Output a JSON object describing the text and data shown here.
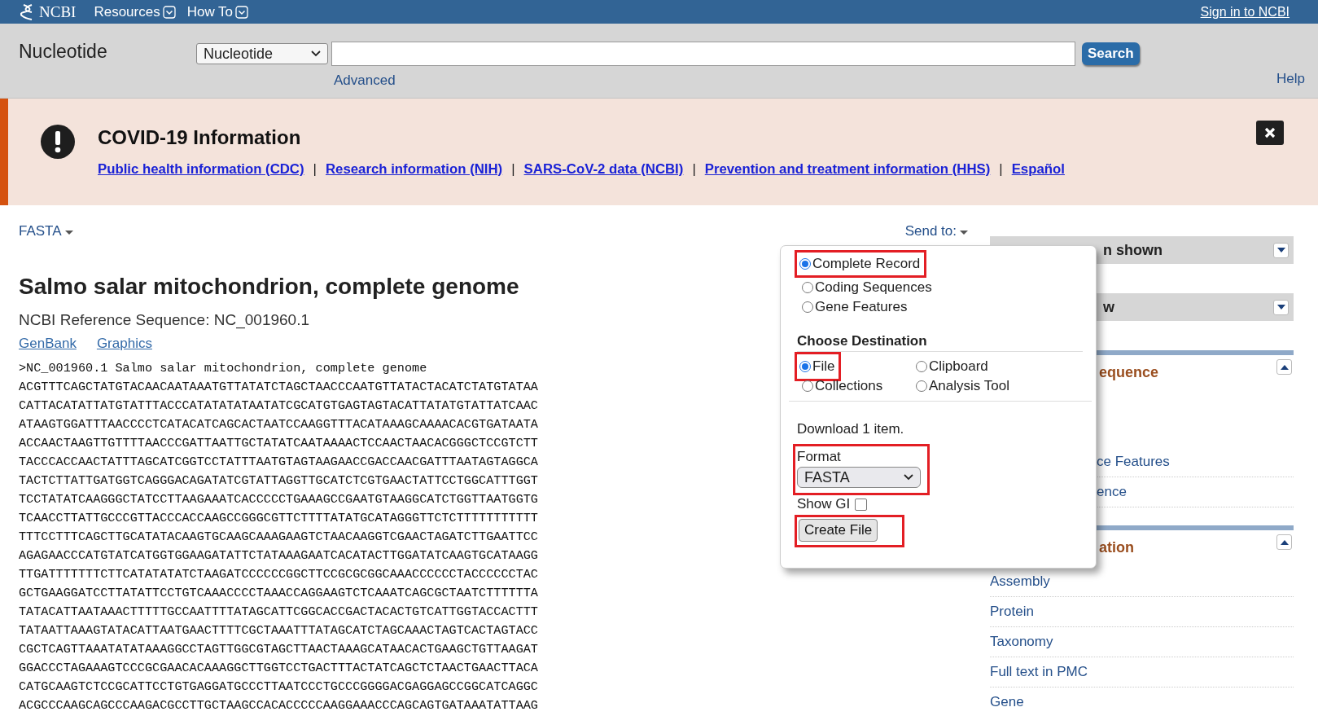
{
  "topbar": {
    "logo": "NCBI",
    "menus": [
      {
        "label": "Resources"
      },
      {
        "label": "How To"
      }
    ],
    "sign_in": "Sign in to NCBI"
  },
  "search": {
    "title": "Nucleotide",
    "database": "Nucleotide",
    "button": "Search",
    "advanced": "Advanced",
    "help": "Help"
  },
  "banner": {
    "title": "COVID-19 Information",
    "links": [
      "Public health information (CDC)",
      "Research information (NIH)",
      "SARS-CoV-2 data (NCBI)",
      "Prevention and treatment information (HHS)",
      "Español"
    ],
    "separator": "|"
  },
  "record": {
    "format": "FASTA",
    "send_to": "Send to:",
    "title": "Salmo salar mitochondrion, complete genome",
    "subtitle": "NCBI Reference Sequence: NC_001960.1",
    "links": [
      "GenBank",
      "Graphics"
    ],
    "fasta_header": ">NC_001960.1 Salmo salar mitochondrion, complete genome",
    "sequence": [
      "ACGTTTCAGCTATGTACAACAATAAATGTTATATCTAGCTAACCCAATGTTATACTACATCTATGTATAA",
      "CATTACATATTATGTATTTACCCATATATATAATATCGCATGTGAGTAGTACATTATATGTATTATCAAC",
      "ATAAGTGGATTTAACCCCTCATACATCAGCACTAATCCAAGGTTTACATAAAGCAAAACACGTGATAATA",
      "ACCAACTAAGTTGTTTTAACCCGATTAATTGCTATATCAATAAAACTCCAACTAACACGGGCTCCGTCTT",
      "TACCCACCAACTATTTAGCATCGGTCCTATTTAATGTAGTAAGAACCGACCAACGATTTAATAGTAGGCA",
      "TACTCTTATTGATGGTCAGGGACAGATATCGTATTAGGTTGCATCTCGTGAACTATTCCTGGCATTTGGT",
      "TCCTATATCAAGGGCTATCCTTAAGAAATCACCCCCTGAAAGCCGAATGTAAGGCATCTGGTTAATGGTG",
      "TCAACCTTATTGCCCGTTACCCACCAAGCCGGGCGTTCTTTTATATGCATAGGGTTCTCTTTTTTTTTTT",
      "TTTCCTTTCAGCTTGCATATACAAGTGCAAGCAAAGAAGTCTAACAAGGTCGAACTAGATCTTGAATTCC",
      "AGAGAACCCATGTATCATGGTGGAAGATATTCTATAAAGAATCACATACTTGGATATCAAGTGCATAAGG",
      "TTGATTTTTTTCTTCATATATATCTAAGATCCCCCCGGCTTCCGCGCGGCAAACCCCCCTACCCCCCTAC",
      "GCTGAAGGATCCTTATATTCCTGTCAAACCCCTAAACCAGGAAGTCTCAAATCAGCGCTAATCTTTTTTA",
      "TATACATTAATAAACTTTTTGCCAATTTTATAGCATTCGGCACCGACTACACTGTCATTGGTACCACTTT",
      "TATAATTAAAGTATACATTAATGAACTTTTCGCTAAATTTATAGCATCTAGCAAACTAGTCACTAGTACC",
      "CGCTCAGTTAAATATATAAAGGCCTAGTTGGCGTAGCTTAACTAAAGCATAACACTGAAGCTGTTAAGAT",
      "GGACCCTAGAAAGTCCCGCGAACACAAAGGCTTGGTCCTGACTTTACTATCAGCTCTAACTGAACTTACA",
      "CATGCAAGTCTCCGCATTCCTGTGAGGATGCCCTTAATCCCTGCCCGGGGACGAGGAGCCGGCATCAGGC",
      "ACGCCCAAGCAGCCCAAGACGCCTTGCTAAGCCACACCCCCAAGGAAACCCAGCAGTGATAAATATTAAG"
    ]
  },
  "send_popup": {
    "options": [
      {
        "label": "Complete Record",
        "selected": true,
        "highlighted": true
      },
      {
        "label": "Coding Sequences",
        "selected": false,
        "highlighted": false
      },
      {
        "label": "Gene Features",
        "selected": false,
        "highlighted": false
      }
    ],
    "destination_heading": "Choose Destination",
    "destinations": [
      {
        "label": "File",
        "selected": true,
        "highlighted": true
      },
      {
        "label": "Clipboard",
        "selected": false,
        "highlighted": false
      },
      {
        "label": "Collections",
        "selected": false,
        "highlighted": false
      },
      {
        "label": "Analysis Tool",
        "selected": false,
        "highlighted": false
      }
    ],
    "download_text": "Download 1 item.",
    "format_label": "Format",
    "format_value": "FASTA",
    "format_highlighted": true,
    "show_gi_label": "Show GI",
    "show_gi_checked": false,
    "create_button": "Create File",
    "create_highlighted": true
  },
  "sidebar": {
    "panels": [
      {
        "kind": "collapsed",
        "title": "n shown"
      },
      {
        "kind": "collapsed",
        "title": "w"
      },
      {
        "kind": "section",
        "title": "equence",
        "items": [
          "ce Features",
          "ence"
        ]
      },
      {
        "kind": "section",
        "title": "ation",
        "items": [
          "Assembly",
          "Protein",
          "Taxonomy",
          "Full text in PMC",
          "Gene"
        ]
      }
    ]
  }
}
